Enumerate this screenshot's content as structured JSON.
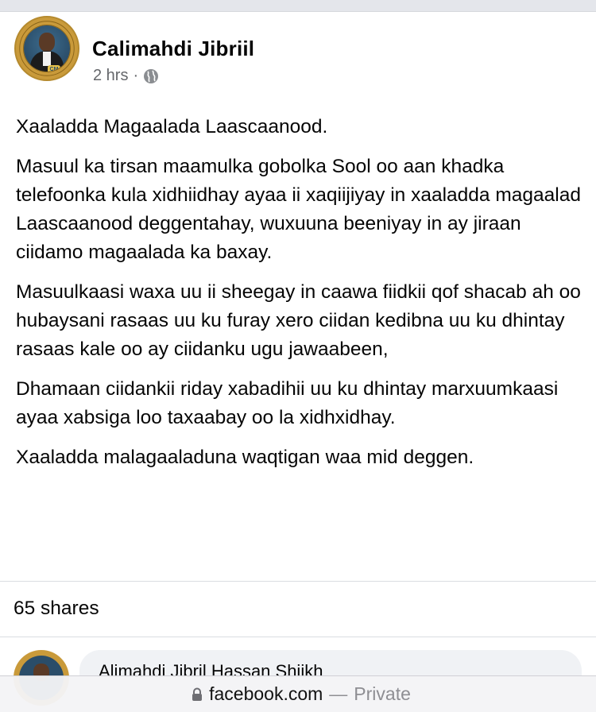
{
  "post": {
    "author": "Calimahdi Jibriil",
    "time": "2 hrs",
    "separator": "·",
    "visibility_icon": "globe-icon",
    "paragraphs": [
      "Xaaladda Magaalada Laascaanood.",
      "Masuul ka tirsan maamulka gobolka Sool oo aan khadka telefoonka kula xidhiidhay ayaa ii xaqiijiyay in xaaladda magaalad Laascaanood deggentahay, wuxuuna beeniyay in ay jiraan ciidamo magaalada ka baxay.",
      "Masuulkaasi waxa uu ii sheegay in caawa fiidkii qof shacab ah oo hubaysani rasaas uu ku furay xero ciidan kedibna uu ku dhintay rasaas kale oo ay ciidanku ugu jawaabeen,",
      "Dhamaan ciidankii riday xabadihii uu ku dhintay marxuumkaasi ayaa xabsiga loo taxaabay oo la xidhxidhay.",
      "Xaaladda malagaaladuna waqtigan waa mid deggen."
    ],
    "shares": "65 shares"
  },
  "comment": {
    "author": "Alimahdi Jibril Hassan Shiikh"
  },
  "browser": {
    "domain": "facebook.com",
    "separator": "—",
    "mode": "Private"
  }
}
